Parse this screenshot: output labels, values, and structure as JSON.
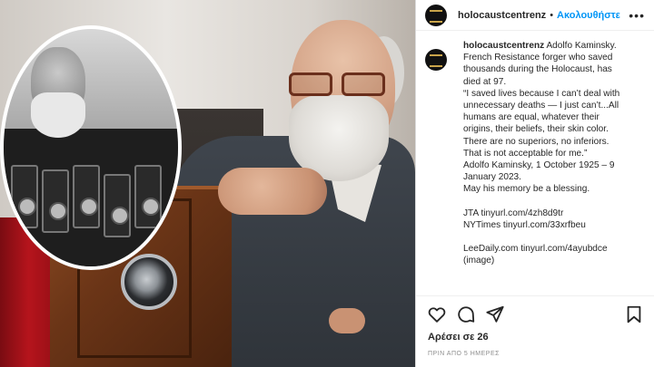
{
  "post": {
    "username": "holocaustcentrenz",
    "separator": "•",
    "follow_label": "Ακολουθήστε",
    "more_icon": "more-horizontal-icon"
  },
  "caption": {
    "username": "holocaustcentrenz",
    "lines": [
      "Adolfo Kaminsky.",
      "French Resistance forger who saved",
      "thousands during the Holocaust, has",
      "died at 97.",
      "“I saved lives because I can’t deal with",
      "unnecessary deaths — I just can’t...All",
      "humans are equal, whatever their",
      "origins, their beliefs, their skin color.",
      "There are no superiors, no inferiors.",
      "That is not acceptable for me.”",
      "Adolfo Kaminsky, 1 October 1925 – 9",
      "January 2023.",
      "May his memory be a blessing."
    ],
    "links": [
      "JTA tinyurl.com/4zh8d9tr",
      "NYTimes tinyurl.com/33xrfbeu"
    ],
    "links2": [
      "LeeDaily.com tinyurl.com/4ayubdce",
      "(image)"
    ]
  },
  "actions": {
    "like_icon": "heart-icon",
    "comment_icon": "comment-icon",
    "share_icon": "send-icon",
    "save_icon": "bookmark-icon"
  },
  "likes": "Αρέσει σε 26",
  "timestamp": "ΠΡΙΝ ΑΠΟ 5 ΗΜΕΡΕΣ",
  "colors": {
    "link_blue": "#0095f6",
    "text": "#262626",
    "muted": "#8e8e8e"
  }
}
